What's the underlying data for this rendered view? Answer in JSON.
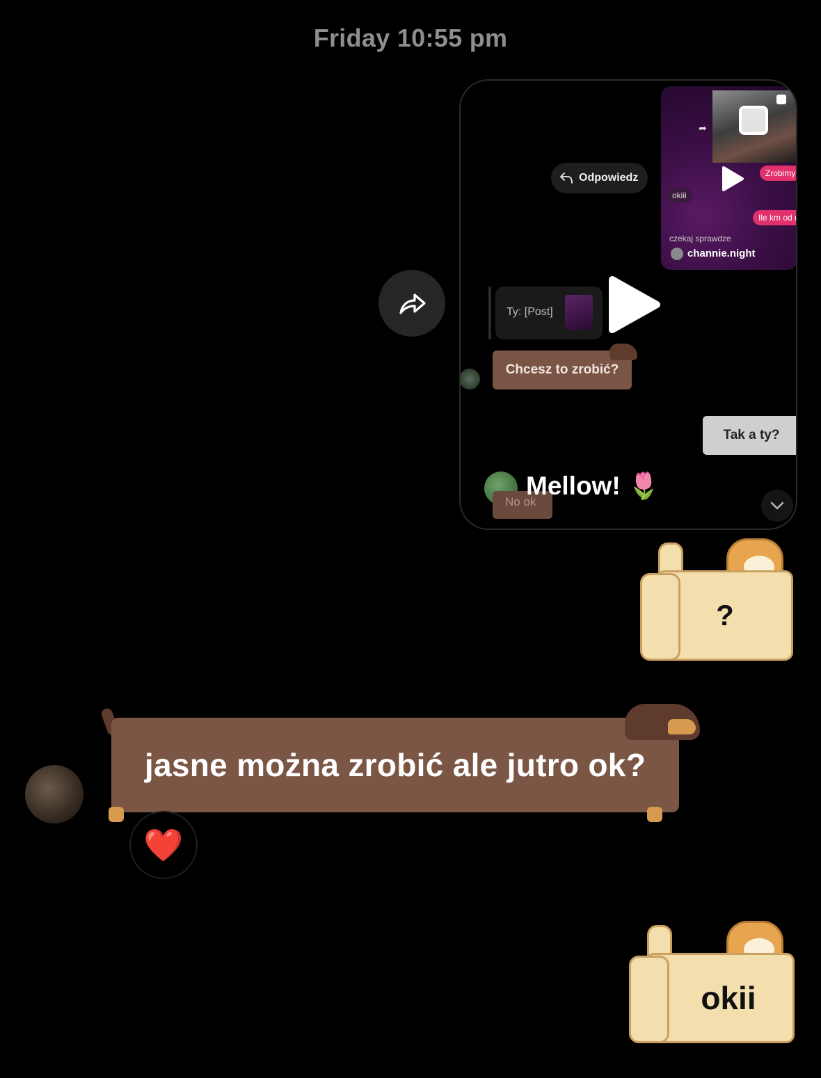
{
  "header": {
    "timestamp": "Friday 10:55 pm"
  },
  "shared_reel": {
    "thumbnail": {
      "bubbles": [
        "Zrobimy",
        "okiii",
        "Ile km od n",
        "czekaj sprawdze"
      ],
      "username": "channie.night"
    },
    "reply_button_label": "Odpowiedz",
    "reply_preview_label": "Ty: [Post]",
    "brown_sign_text": "Chcesz to zrobić?",
    "grey_sign_text": "Tak a ty?",
    "hidden_sign_text": "No ok",
    "caption": "Mellow! 🌷"
  },
  "messages": [
    {
      "sender": "me",
      "type": "doge-sign",
      "text": "?"
    },
    {
      "sender": "them",
      "type": "dachshund-sign",
      "text": "jasne można zrobić ale jutro ok?",
      "reaction": "❤️"
    },
    {
      "sender": "me",
      "type": "doge-sign",
      "text": "okii"
    }
  ],
  "icons": {
    "share": "share-arrow-icon",
    "play": "play-icon",
    "chevron": "chevron-down-icon",
    "reply": "reply-arrow-icon"
  },
  "colors": {
    "background": "#000000",
    "timestamp": "#8e8e8e",
    "dachshund_sign": "#7b5645",
    "doge_sign": "#f3dfae",
    "pink_bubble": "#e1306c"
  }
}
